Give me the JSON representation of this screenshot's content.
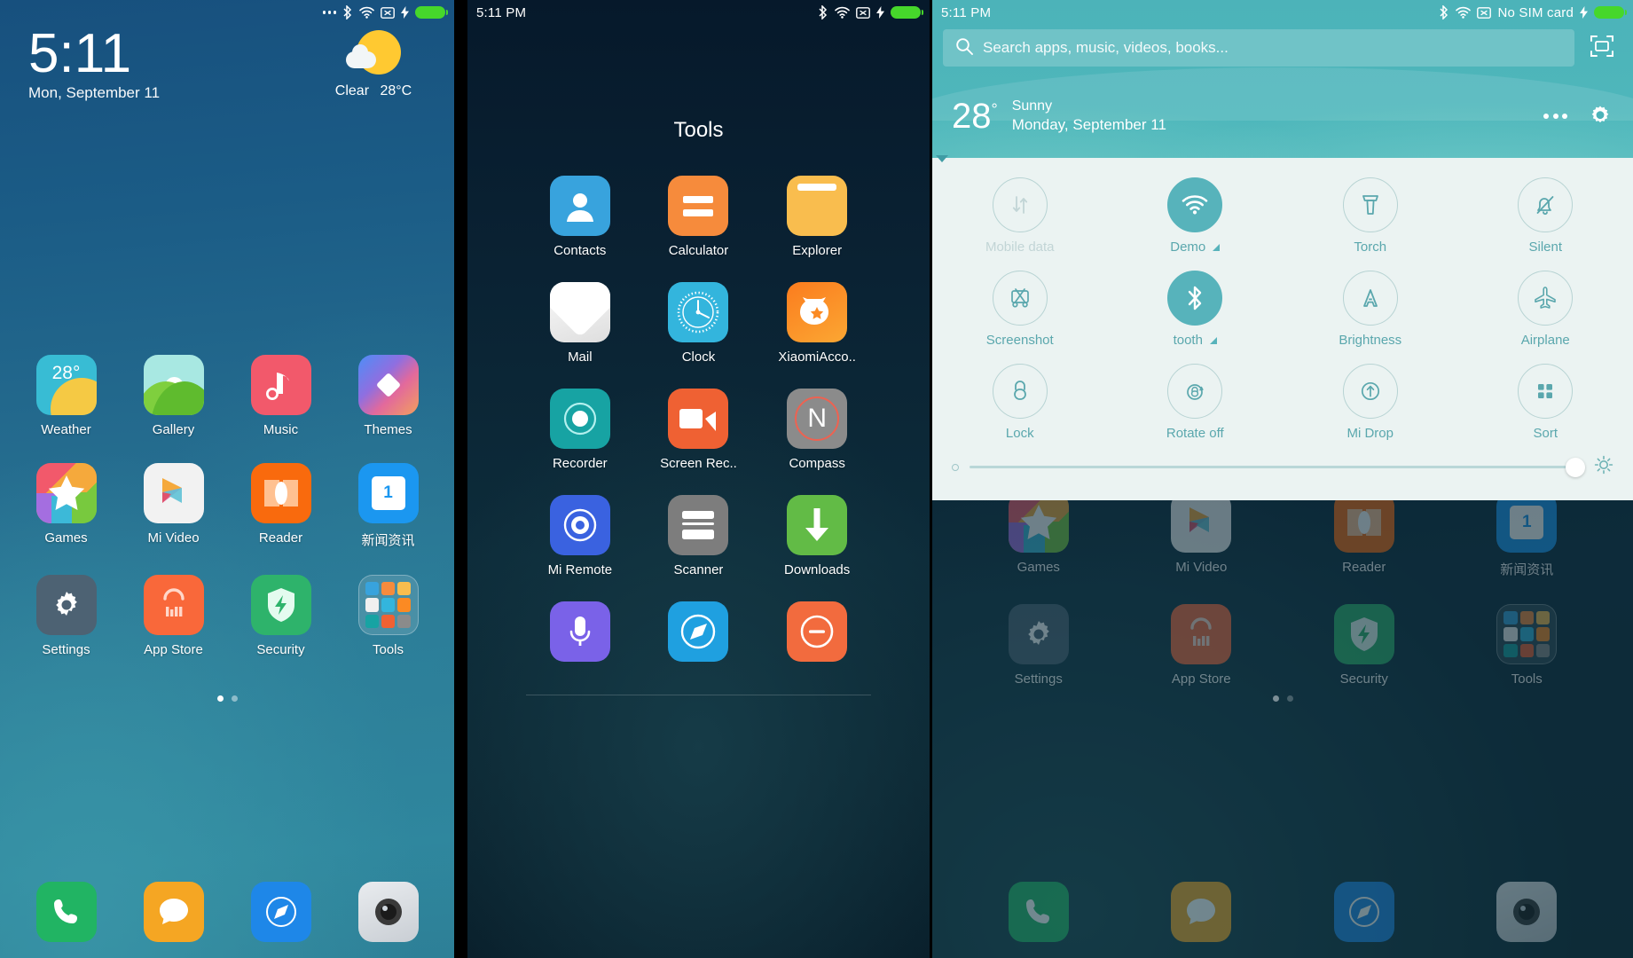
{
  "panel1": {
    "statusbar": {
      "icons": [
        "more-dots",
        "bluetooth",
        "wifi",
        "sms-x",
        "charging",
        "battery"
      ]
    },
    "clock": {
      "time": "5:11",
      "date": "Mon, September 11"
    },
    "weather": {
      "condition": "Clear",
      "temperature": "28°C"
    },
    "apps": [
      {
        "label": "Weather",
        "icon": "weather-icon",
        "badge": "28°"
      },
      {
        "label": "Gallery",
        "icon": "gallery-icon"
      },
      {
        "label": "Music",
        "icon": "music-icon"
      },
      {
        "label": "Themes",
        "icon": "themes-icon"
      },
      {
        "label": "Games",
        "icon": "games-icon"
      },
      {
        "label": "Mi Video",
        "icon": "mi-video-icon"
      },
      {
        "label": "Reader",
        "icon": "reader-icon"
      },
      {
        "label": "新闻资讯",
        "icon": "news-icon",
        "badge": "1"
      },
      {
        "label": "Settings",
        "icon": "settings-gear-icon"
      },
      {
        "label": "App Store",
        "icon": "app-store-icon"
      },
      {
        "label": "Security",
        "icon": "security-shield-icon"
      },
      {
        "label": "Tools",
        "icon": "tools-folder-icon"
      }
    ],
    "pages": {
      "count": 2,
      "active": 0
    },
    "dock": [
      {
        "label": "Phone",
        "icon": "phone-icon"
      },
      {
        "label": "Messaging",
        "icon": "message-icon"
      },
      {
        "label": "Browser",
        "icon": "browser-icon"
      },
      {
        "label": "Camera",
        "icon": "camera-icon"
      }
    ]
  },
  "panel2": {
    "statusbar": {
      "time": "5:11 PM",
      "icons": [
        "bluetooth",
        "wifi",
        "sms-x",
        "charging",
        "battery"
      ]
    },
    "folder_title": "Tools",
    "apps": [
      {
        "label": "Contacts",
        "icon": "contacts-icon"
      },
      {
        "label": "Calculator",
        "icon": "calculator-icon"
      },
      {
        "label": "Explorer",
        "icon": "explorer-folder-icon"
      },
      {
        "label": "Mail",
        "icon": "mail-envelope-icon"
      },
      {
        "label": "Clock",
        "icon": "clock-icon"
      },
      {
        "label": "XiaomiAcco..",
        "icon": "xiaomi-account-icon"
      },
      {
        "label": "Recorder",
        "icon": "recorder-icon"
      },
      {
        "label": "Screen Rec..",
        "icon": "screen-recorder-icon"
      },
      {
        "label": "Compass",
        "icon": "compass-icon"
      },
      {
        "label": "Mi Remote",
        "icon": "mi-remote-icon"
      },
      {
        "label": "Scanner",
        "icon": "scanner-icon"
      },
      {
        "label": "Downloads",
        "icon": "downloads-icon"
      },
      {
        "label": "",
        "icon": "voice-assistant-icon"
      },
      {
        "label": "",
        "icon": "browser-compass-icon"
      },
      {
        "label": "",
        "icon": "feedback-icon"
      }
    ]
  },
  "panel3": {
    "statusbar": {
      "time": "5:11 PM",
      "sim": "No SIM card",
      "icons": [
        "bluetooth",
        "wifi",
        "sms-x",
        "sim",
        "charging",
        "battery"
      ]
    },
    "search": {
      "placeholder": "Search apps, music, videos, books...",
      "icon": "search-icon",
      "scan_icon": "qr-scan-icon"
    },
    "weather": {
      "temperature": "28",
      "degree": "°",
      "condition": "Sunny",
      "date": "Monday, September 11",
      "more_icon": "more-dots-icon",
      "settings_icon": "gear-icon"
    },
    "toggles": [
      {
        "label": "Mobile data",
        "icon": "mobile-data-icon",
        "on": false,
        "disabled": true,
        "caret": false
      },
      {
        "label": "Demo",
        "icon": "wifi-icon",
        "on": true,
        "disabled": false,
        "caret": true
      },
      {
        "label": "Torch",
        "icon": "torch-icon",
        "on": false,
        "disabled": false,
        "caret": false
      },
      {
        "label": "Silent",
        "icon": "silent-bell-icon",
        "on": false,
        "disabled": false,
        "caret": false
      },
      {
        "label": "Screenshot",
        "icon": "screenshot-icon",
        "on": false,
        "disabled": false,
        "caret": false
      },
      {
        "label": "tooth",
        "icon": "bluetooth-icon",
        "on": true,
        "disabled": false,
        "caret": true
      },
      {
        "label": "Brightness",
        "icon": "brightness-a-icon",
        "on": false,
        "disabled": false,
        "caret": false
      },
      {
        "label": "Airplane",
        "icon": "airplane-icon",
        "on": false,
        "disabled": false,
        "caret": false
      },
      {
        "label": "Lock",
        "icon": "lock-icon",
        "on": false,
        "disabled": false,
        "caret": false
      },
      {
        "label": "Rotate off",
        "icon": "rotate-lock-icon",
        "on": false,
        "disabled": false,
        "caret": false
      },
      {
        "label": "Mi Drop",
        "icon": "mi-drop-icon",
        "on": false,
        "disabled": false,
        "caret": false
      },
      {
        "label": "Sort",
        "icon": "sort-grid-icon",
        "on": false,
        "disabled": false,
        "caret": false
      }
    ],
    "brightness": {
      "value": 96,
      "left_icon": "brightness-low-icon",
      "right_icon": "brightness-high-icon"
    },
    "background_apps": [
      {
        "label": "Games"
      },
      {
        "label": "Mi Video"
      },
      {
        "label": "Reader"
      },
      {
        "label": "新闻资讯"
      },
      {
        "label": "Settings"
      },
      {
        "label": "App Store"
      },
      {
        "label": "Security"
      },
      {
        "label": "Tools"
      }
    ],
    "pages": {
      "count": 2,
      "active": 0
    }
  },
  "colors": {
    "home_wall_top": "#17507e",
    "home_wall_bottom": "#30899f",
    "folder_bg": "#0a2233",
    "shade_header": "#4cb3b9",
    "shade_body": "#ebf3f2",
    "toggle_on": "#57b3bb",
    "toggle_label": "#5aa7ad",
    "battery_green": "#46d72b"
  }
}
